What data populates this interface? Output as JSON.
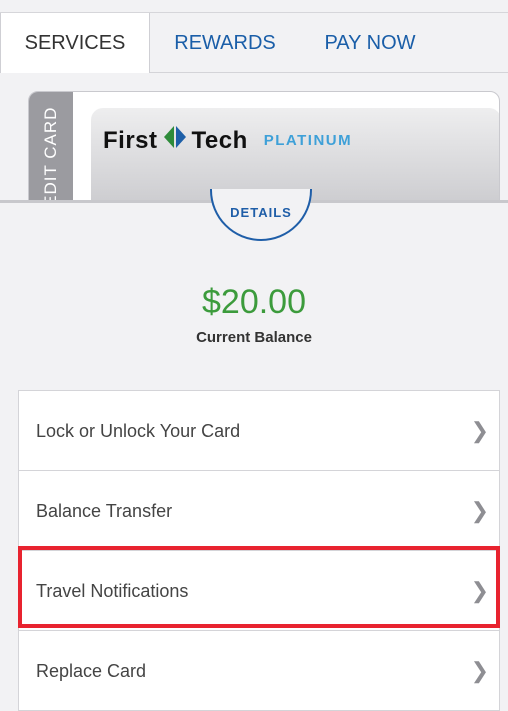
{
  "tabs": [
    {
      "label": "SERVICES",
      "active": true
    },
    {
      "label": "REWARDS",
      "active": false
    },
    {
      "label": "PAY NOW",
      "active": false
    }
  ],
  "card": {
    "side_label": "CREDIT CARD",
    "brand_first": "First",
    "brand_second": "Tech",
    "tier": "PLATINUM"
  },
  "details_label": "DETAILS",
  "balance": {
    "amount": "$20.00",
    "label": "Current Balance"
  },
  "menu": [
    {
      "label": "Lock or Unlock Your Card",
      "icon": "chevron-right-icon"
    },
    {
      "label": "Balance Transfer",
      "icon": "chevron-right-icon"
    },
    {
      "label": "Travel Notifications",
      "icon": "chevron-right-icon",
      "highlighted": true
    },
    {
      "label": "Replace Card",
      "icon": "chevron-right-icon"
    }
  ],
  "colors": {
    "accent": "#1f5ea8",
    "balance_green": "#3c9b3c",
    "highlight_red": "#e8232f"
  }
}
